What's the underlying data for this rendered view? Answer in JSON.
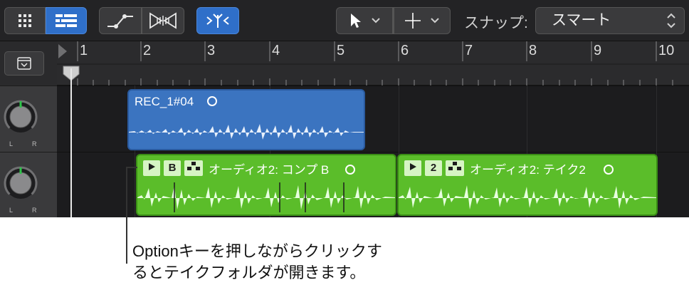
{
  "toolbar": {
    "snap_label": "スナップ:",
    "snap_value": "スマート",
    "buttons": [
      "grid-view",
      "list-view",
      "automation",
      "flex",
      "catch",
      "pointer-tool",
      "marquee-tool"
    ]
  },
  "ruler": {
    "bars": [
      "1",
      "2",
      "3",
      "4",
      "5",
      "6",
      "7",
      "8",
      "9",
      "10"
    ]
  },
  "tracks": [
    {
      "knob_left": "L",
      "knob_right": "R"
    },
    {
      "knob_left": "L",
      "knob_right": "R"
    }
  ],
  "regions": {
    "rec": {
      "title": "REC_1#04"
    },
    "comp": {
      "tag_b": "B",
      "title": "オーディオ2: コンプ B"
    },
    "take": {
      "tag_2": "2",
      "title": "オーディオ2: テイク2"
    }
  },
  "callout": {
    "line1": "Optionキーを押しながらクリックす",
    "line2": "るとテイクフォルダが開きます。"
  },
  "colors": {
    "toolbar": "#232325",
    "accent_blue": "#2f6fc9",
    "region_blue": "#3b74c0",
    "region_green": "#5bbd2a"
  }
}
